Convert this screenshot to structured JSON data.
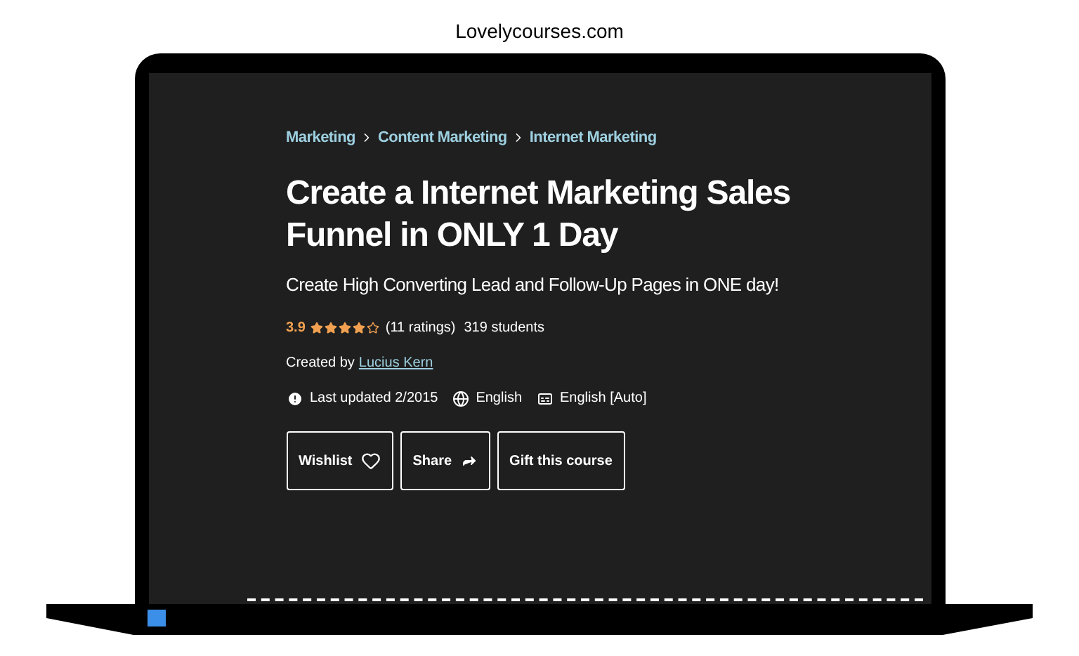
{
  "site_title": "Lovelycourses.com",
  "breadcrumbs": [
    "Marketing",
    "Content Marketing",
    "Internet Marketing"
  ],
  "title": "Create a Internet Marketing Sales Funnel in ONLY 1 Day",
  "subtitle": "Create High Converting Lead and Follow-Up Pages in ONE day!",
  "rating": {
    "score": "3.9",
    "stars": 4,
    "ratings": "(11 ratings)",
    "students": "319 students"
  },
  "author": {
    "label": "Created by",
    "name": "Lucius Kern"
  },
  "meta": [
    {
      "kind": "updated",
      "text": "Last updated 2/2015"
    },
    {
      "kind": "language",
      "text": "English"
    },
    {
      "kind": "captions",
      "text": "English [Auto]"
    }
  ],
  "buttons": [
    {
      "kind": "wishlist",
      "label": "Wishlist"
    },
    {
      "kind": "share",
      "label": "Share"
    },
    {
      "kind": "gift",
      "label": "Gift this course"
    }
  ]
}
